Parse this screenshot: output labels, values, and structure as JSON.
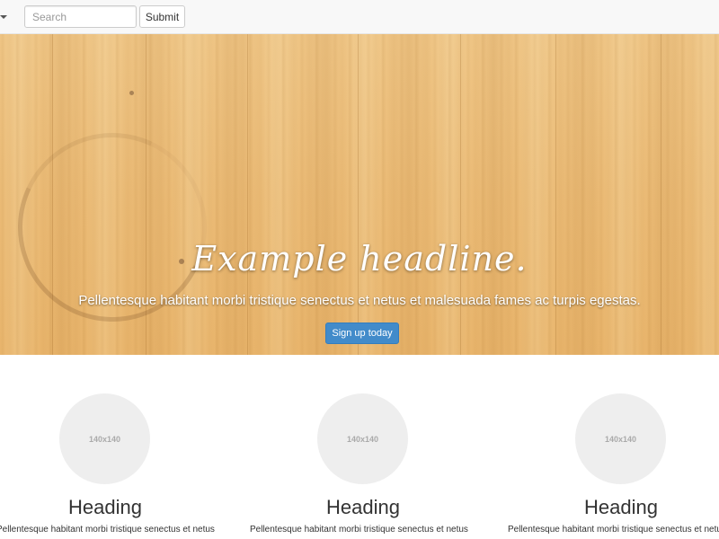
{
  "navbar": {
    "search": {
      "placeholder": "Search",
      "value": ""
    },
    "submit_label": "Submit"
  },
  "hero": {
    "headline": "Example headline.",
    "text": "Pellentesque habitant morbi tristique senectus et netus et malesuada fames ac turpis egestas.",
    "button_label": "Sign up today",
    "slides": {
      "count": 3,
      "active": 1
    }
  },
  "columns": [
    {
      "image_label": "140x140",
      "heading": "Heading",
      "text": "Pellentesque habitant morbi tristique senectus et netus"
    },
    {
      "image_label": "140x140",
      "heading": "Heading",
      "text": "Pellentesque habitant morbi tristique senectus et netus"
    },
    {
      "image_label": "140x140",
      "heading": "Heading",
      "text": "Pellentesque habitant morbi tristique senectus et netus"
    }
  ],
  "colors": {
    "primary_button": "#428bca",
    "navbar_bg": "#f8f8f8",
    "placeholder_circle": "#eeeeee",
    "hero_wood": "#ebbb76"
  }
}
